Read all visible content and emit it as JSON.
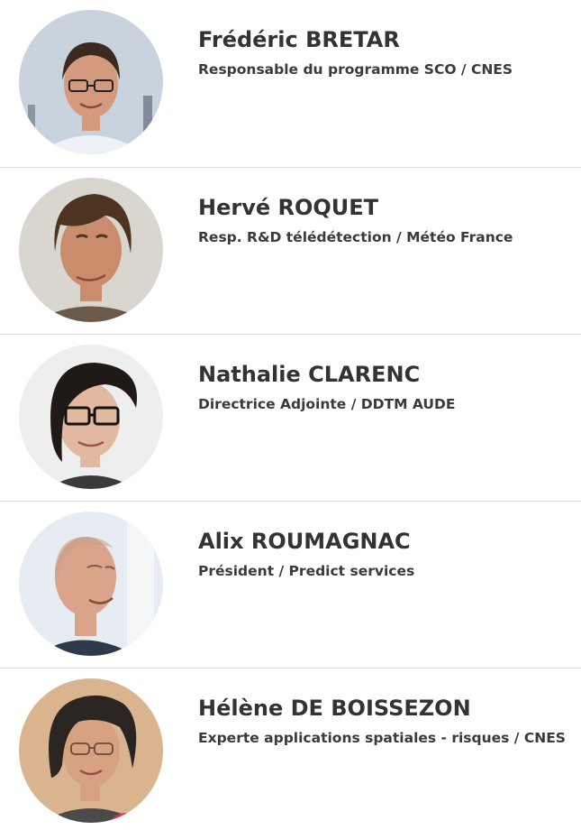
{
  "speakers": [
    {
      "name": "Frédéric BRETAR",
      "role": "Responsable du programme SCO / CNES",
      "photo": {
        "bg": "#c9d3de",
        "skin": "#d49a7e",
        "hair": "#3b2a20",
        "shirt": "#eef2f6",
        "glasses": true
      }
    },
    {
      "name": "Hervé ROQUET",
      "role": "Resp. R&D télédétection / Météo France",
      "photo": {
        "bg": "#d8d6cf",
        "skin": "#c98d6e",
        "hair": "#4d3422",
        "shirt": "#6b5a4c",
        "glasses": false
      }
    },
    {
      "name": "Nathalie CLARENC",
      "role": "Directrice Adjointe / DDTM AUDE",
      "photo": {
        "bg": "#eeeeee",
        "skin": "#e2b9a0",
        "hair": "#1f1a17",
        "shirt": "#3a3a3a",
        "glasses": true
      }
    },
    {
      "name": "Alix ROUMAGNAC",
      "role": "Président / Predict services",
      "photo": {
        "bg": "#e6ecf2",
        "skin": "#d9a48a",
        "hair": "#c9a08a",
        "shirt": "#2d3a4a",
        "glasses": false
      }
    },
    {
      "name": "Hélène DE BOISSEZON",
      "role": "Experte applications spatiales - risques / CNES",
      "photo": {
        "bg": "#d9b48f",
        "skin": "#d7a282",
        "hair": "#2b2522",
        "shirt": "#4a4a4a",
        "glasses": true
      }
    }
  ]
}
